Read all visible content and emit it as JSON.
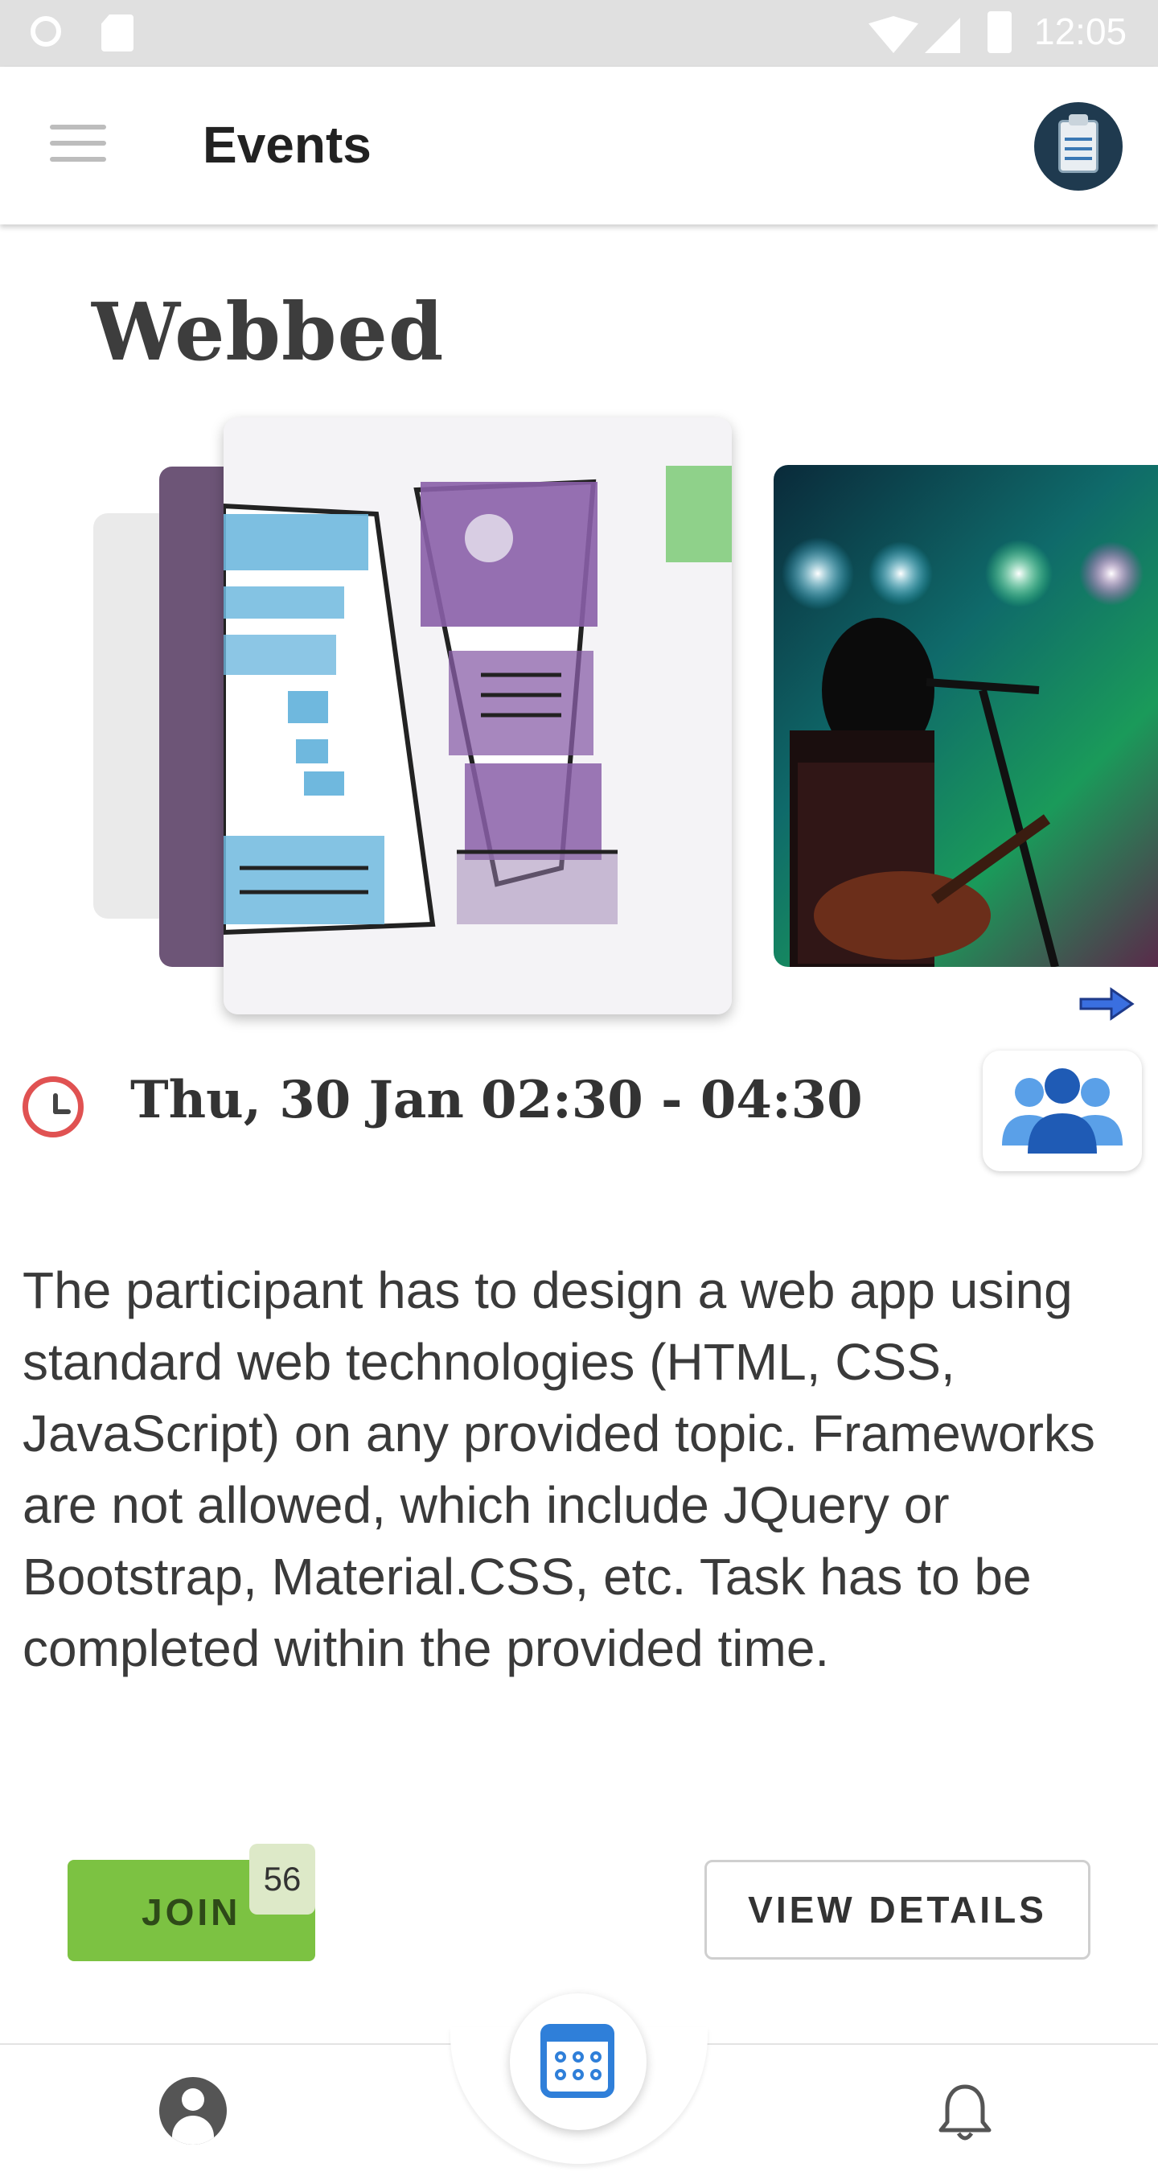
{
  "status_bar": {
    "time": "12:05"
  },
  "app_bar": {
    "title": "Events"
  },
  "event": {
    "name": "Webbed",
    "date": "Thu, 30 Jan",
    "time_range": "02:30 - 04:30",
    "description": "The participant has to design a web app using standard web technologies (HTML, CSS, JavaScript) on any provided topic. Frameworks are not allowed, which include JQuery or Bootstrap, Material.CSS, etc. Task has to be completed within the provided time."
  },
  "actions": {
    "join_label": "JOIN",
    "join_count": "56",
    "details_label": "VIEW DETAILS"
  },
  "colors": {
    "accent_green": "#7cc242",
    "accent_blue": "#2f7fd9",
    "clock_red": "#e05252"
  },
  "icons": [
    "menu-icon",
    "clipboard-icon",
    "clock-icon",
    "team-icon",
    "next-arrow-icon",
    "profile-icon",
    "calendar-icon",
    "bell-icon"
  ]
}
